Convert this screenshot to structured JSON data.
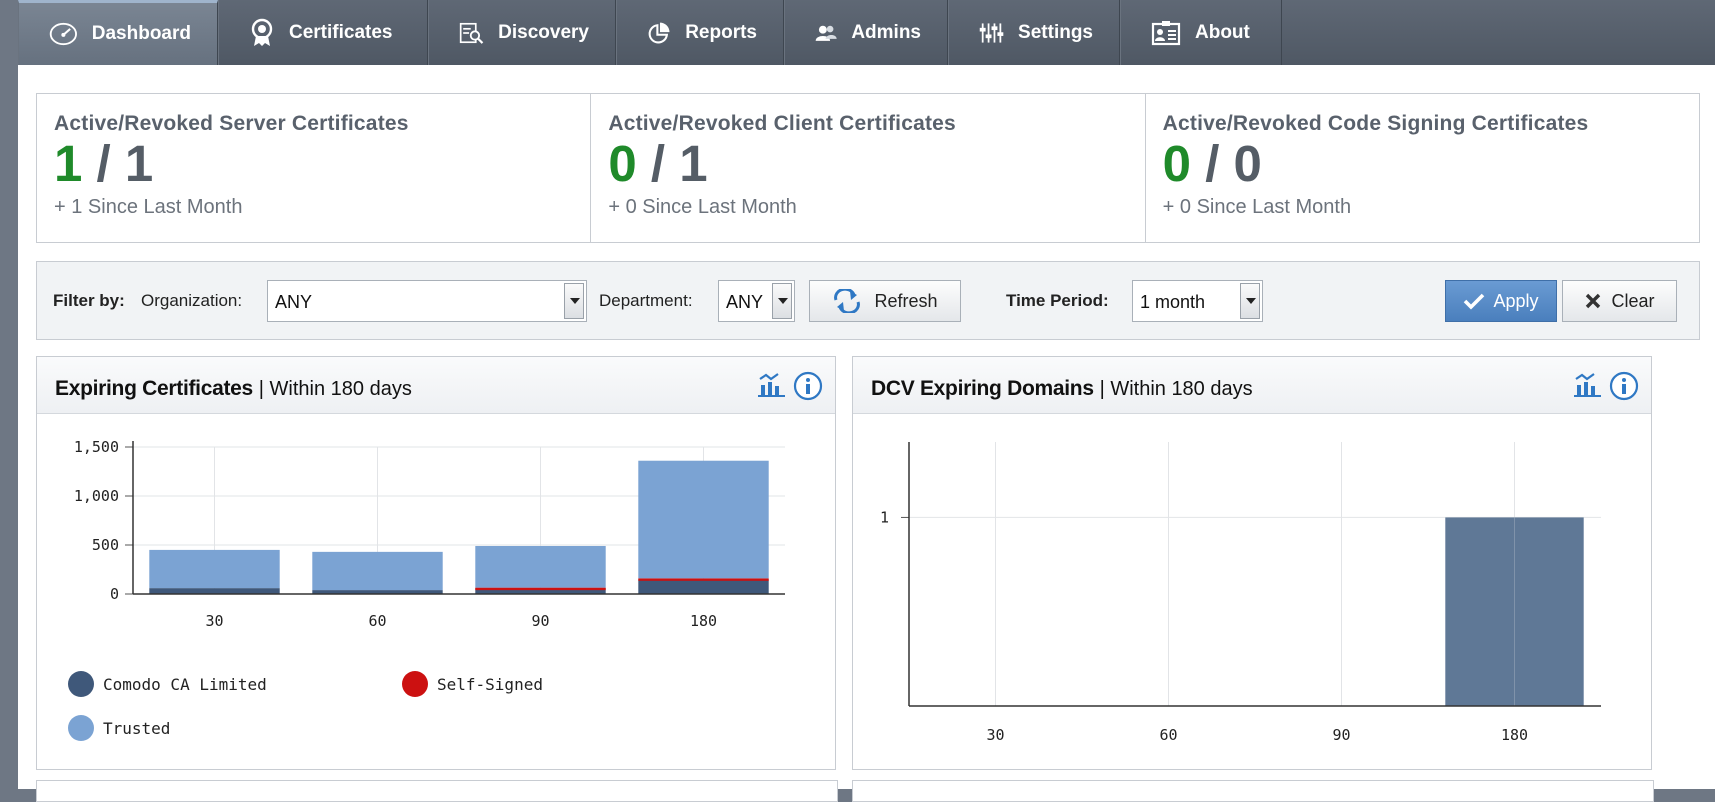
{
  "nav": {
    "items": [
      {
        "label": "Dashboard",
        "icon": "gauge-icon",
        "active": true
      },
      {
        "label": "Certificates",
        "icon": "certificate-icon"
      },
      {
        "label": "Discovery",
        "icon": "discovery-icon"
      },
      {
        "label": "Reports",
        "icon": "reports-icon"
      },
      {
        "label": "Admins",
        "icon": "admins-icon"
      },
      {
        "label": "Settings",
        "icon": "settings-icon"
      },
      {
        "label": "About",
        "icon": "about-icon"
      }
    ]
  },
  "stats": [
    {
      "title": "Active/Revoked Server Certificates",
      "active": "1",
      "sep": "/",
      "revoked": "1",
      "since": "+ 1 Since Last Month"
    },
    {
      "title": "Active/Revoked Client Certificates",
      "active": "0",
      "sep": "/",
      "revoked": "1",
      "since": "+ 0 Since Last Month"
    },
    {
      "title": "Active/Revoked Code Signing Certificates",
      "active": "0",
      "sep": "/",
      "revoked": "0",
      "since": "+ 0 Since Last Month"
    }
  ],
  "filter": {
    "label": "Filter by:",
    "org_label": "Organization:",
    "org_value": "ANY",
    "dept_label": "Department:",
    "dept_value": "ANY",
    "refresh_label": "Refresh",
    "period_label": "Time Period:",
    "period_value": "1 month",
    "apply_label": "Apply",
    "clear_label": "Clear"
  },
  "panels": {
    "expiring": {
      "title": "Expiring Certificates",
      "subtitle": "| Within 180 days"
    },
    "dcv": {
      "title": "DCV Expiring Domains",
      "subtitle": "| Within 180 days"
    }
  },
  "colors": {
    "trusted": "#7ba3d3",
    "comodo": "#3f587a",
    "self_signed": "#cc1111",
    "dcv_bar": "#5f7896",
    "active_green": "#1f8a2a"
  },
  "chart_data": [
    {
      "type": "bar",
      "categories": [
        "30",
        "60",
        "90",
        "180"
      ],
      "series": [
        {
          "name": "Comodo CA Limited",
          "values": [
            60,
            40,
            60,
            150
          ]
        },
        {
          "name": "Self-Signed",
          "values": [
            0,
            0,
            5,
            10
          ]
        },
        {
          "name": "Trusted",
          "values": [
            390,
            390,
            425,
            1200
          ]
        }
      ],
      "stacked": true,
      "ylim": [
        0,
        1500
      ],
      "yticks": [
        "0",
        "500",
        "1,000",
        "1,500"
      ],
      "ytick_values": [
        0,
        500,
        1000,
        1500
      ],
      "grid": true,
      "legend": "bottom"
    },
    {
      "type": "bar",
      "categories": [
        "30",
        "60",
        "90",
        "180"
      ],
      "values": [
        0,
        0,
        0,
        1
      ],
      "ylim": [
        0,
        1.4
      ],
      "yticks": [
        "1"
      ],
      "ytick_values": [
        1
      ],
      "grid": true
    }
  ]
}
